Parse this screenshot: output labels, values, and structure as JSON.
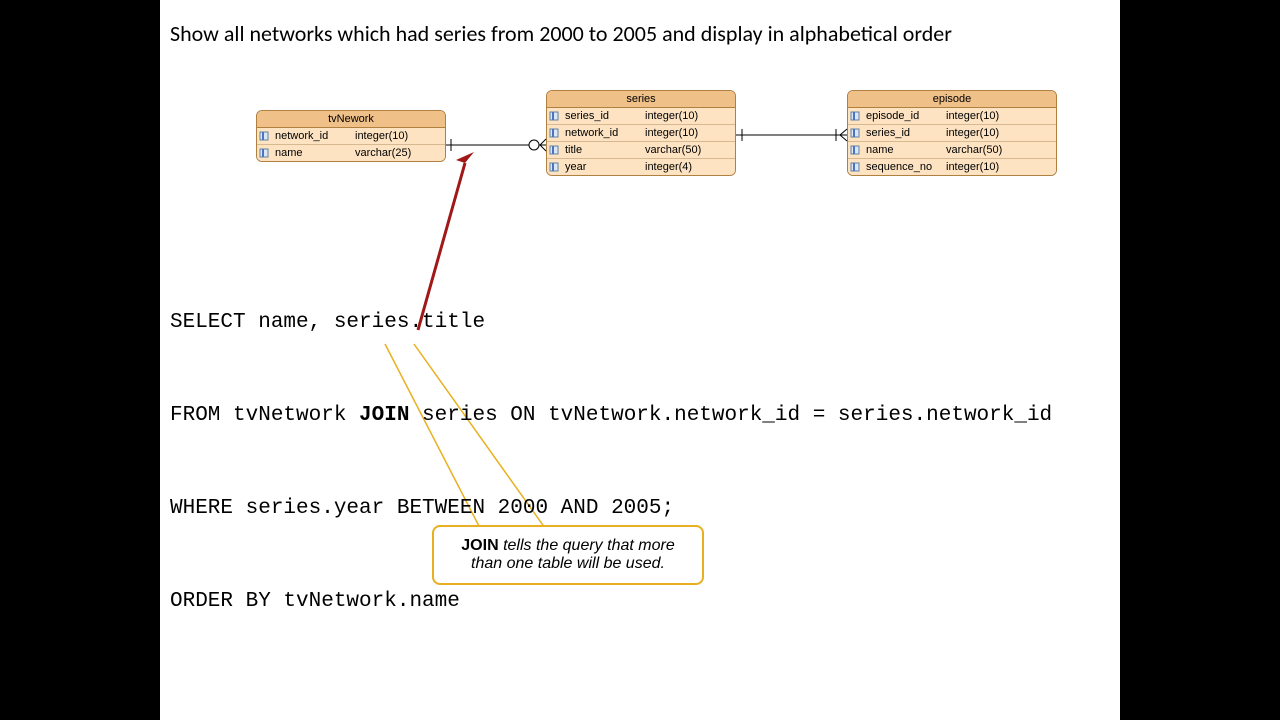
{
  "heading": "Show all networks which had series from 2000 to 2005 and display in alphabetical order",
  "tables": {
    "tvNework": {
      "title": "tvNework",
      "rows": [
        {
          "name": "network_id",
          "type": "integer(10)"
        },
        {
          "name": "name",
          "type": "varchar(25)"
        }
      ]
    },
    "series": {
      "title": "series",
      "rows": [
        {
          "name": "series_id",
          "type": "integer(10)"
        },
        {
          "name": "network_id",
          "type": "integer(10)"
        },
        {
          "name": "title",
          "type": "varchar(50)"
        },
        {
          "name": "year",
          "type": "integer(4)"
        }
      ]
    },
    "episode": {
      "title": "episode",
      "rows": [
        {
          "name": "episode_id",
          "type": "integer(10)"
        },
        {
          "name": "series_id",
          "type": "integer(10)"
        },
        {
          "name": "name",
          "type": "varchar(50)"
        },
        {
          "name": "sequence_no",
          "type": "integer(10)"
        }
      ]
    }
  },
  "sql": {
    "line1_pre": "SELECT name, series.title",
    "line2_pre": "FROM tvNetwork ",
    "line2_kw": "JOIN",
    "line2_post": " series ON tvNetwork.network_id = series.network_id",
    "line3": "WHERE series.year BETWEEN 2000 AND 2005;",
    "line4": "ORDER BY tvNetwork.name"
  },
  "callout": {
    "kw": "JOIN",
    "text": " tells the query that more than one table will be used."
  },
  "chart_data": {
    "type": "table",
    "description": "Entity-relationship diagram with three tables and SQL query example",
    "entities": [
      {
        "name": "tvNework",
        "columns": [
          {
            "name": "network_id",
            "type": "integer(10)"
          },
          {
            "name": "name",
            "type": "varchar(25)"
          }
        ]
      },
      {
        "name": "series",
        "columns": [
          {
            "name": "series_id",
            "type": "integer(10)"
          },
          {
            "name": "network_id",
            "type": "integer(10)"
          },
          {
            "name": "title",
            "type": "varchar(50)"
          },
          {
            "name": "year",
            "type": "integer(4)"
          }
        ]
      },
      {
        "name": "episode",
        "columns": [
          {
            "name": "episode_id",
            "type": "integer(10)"
          },
          {
            "name": "series_id",
            "type": "integer(10)"
          },
          {
            "name": "name",
            "type": "varchar(50)"
          },
          {
            "name": "sequence_no",
            "type": "integer(10)"
          }
        ]
      }
    ],
    "relationships": [
      {
        "from": "tvNework",
        "to": "series",
        "type": "one-to-many"
      },
      {
        "from": "series",
        "to": "episode",
        "type": "one-to-many"
      }
    ],
    "sql_query": "SELECT name, series.title\nFROM tvNetwork JOIN series ON tvNetwork.network_id = series.network_id\nWHERE series.year BETWEEN 2000 AND 2005;\nORDER BY tvNetwork.name",
    "annotation": "JOIN tells the query that more than one table will be used."
  }
}
